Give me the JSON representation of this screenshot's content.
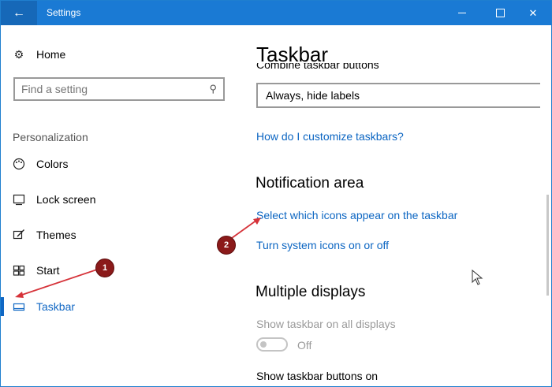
{
  "window": {
    "title": "Settings",
    "back_icon": "back-arrow-icon",
    "minimize_icon": "minimize-icon",
    "maximize_icon": "maximize-icon",
    "close_icon": "close-icon"
  },
  "sidebar": {
    "home_label": "Home",
    "search_placeholder": "Find a setting",
    "section_label": "Personalization",
    "items": [
      {
        "label": "Colors",
        "icon": "palette-icon"
      },
      {
        "label": "Lock screen",
        "icon": "lock-screen-icon"
      },
      {
        "label": "Themes",
        "icon": "brush-icon"
      },
      {
        "label": "Start",
        "icon": "start-icon"
      },
      {
        "label": "Taskbar",
        "icon": "taskbar-icon"
      }
    ]
  },
  "main": {
    "title": "Taskbar",
    "combine_label": "Combine taskbar buttons",
    "combine_value": "Always, hide labels",
    "customize_link": "How do I customize taskbars?",
    "notification_heading": "Notification area",
    "select_icons_link": "Select which icons appear on the taskbar",
    "system_icons_link": "Turn system icons on or off",
    "multiple_heading": "Multiple displays",
    "show_all_label": "Show taskbar on all displays",
    "toggle_state": "Off",
    "show_buttons_label": "Show taskbar buttons on"
  },
  "annotations": {
    "badge_1": "1",
    "badge_2": "2"
  },
  "colors": {
    "accent": "#1067c4",
    "titlebar": "#1a7ad4",
    "annotation": "#d6333a"
  }
}
